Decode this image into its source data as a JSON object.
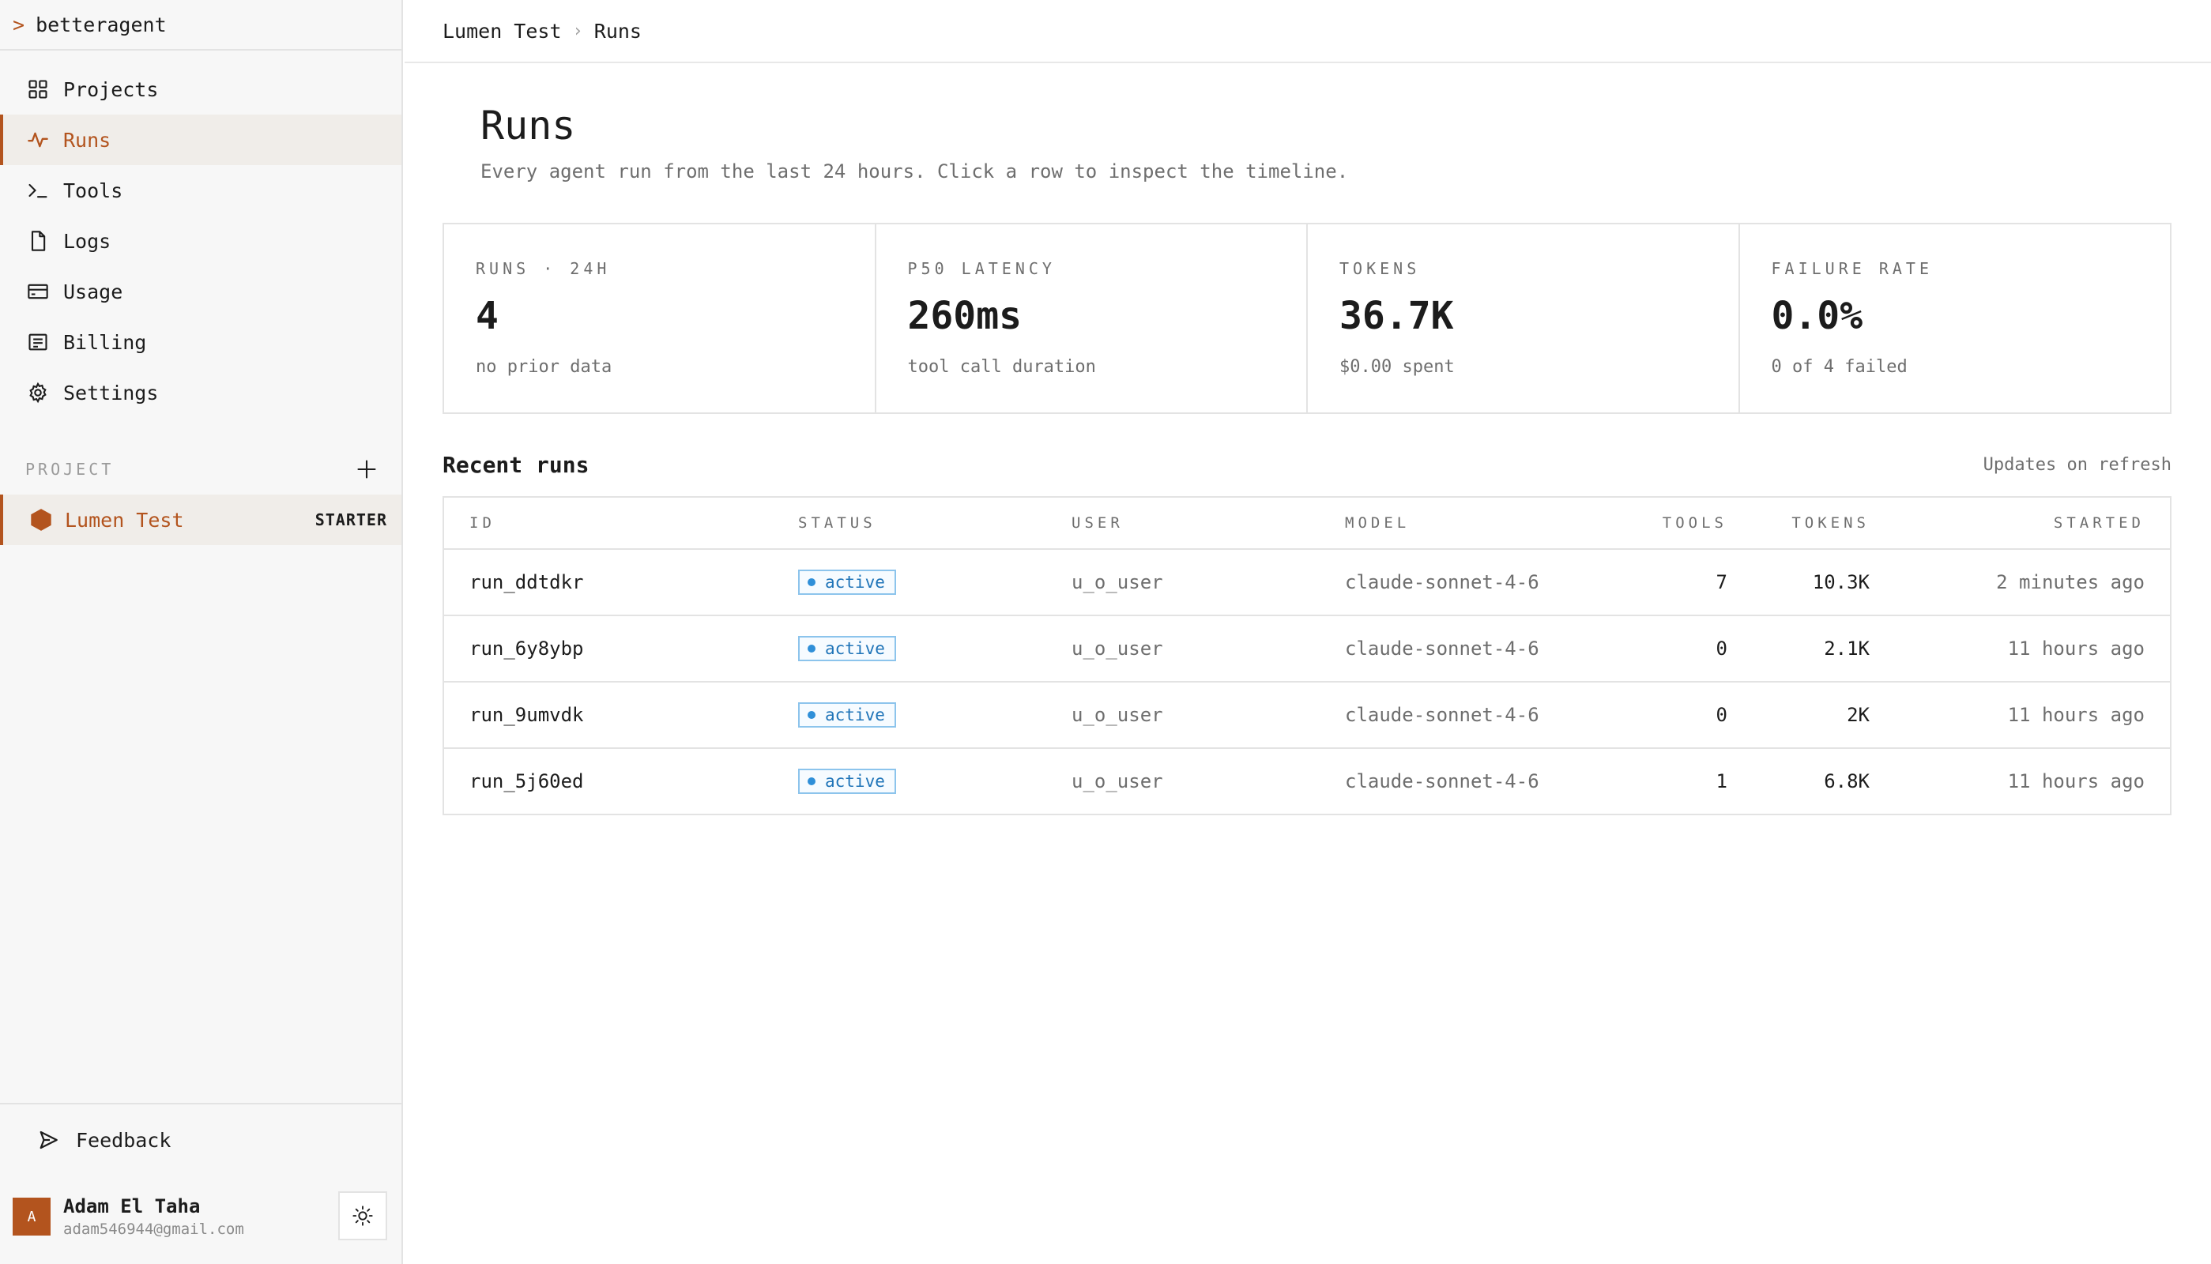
{
  "app": {
    "prompt_glyph": ">",
    "brand": "betteragent"
  },
  "sidebar": {
    "nav": [
      {
        "label": "Projects",
        "icon": "grid-icon"
      },
      {
        "label": "Runs",
        "icon": "activity-icon",
        "active": true
      },
      {
        "label": "Tools",
        "icon": "terminal-icon"
      },
      {
        "label": "Logs",
        "icon": "file-icon"
      },
      {
        "label": "Usage",
        "icon": "card-icon"
      },
      {
        "label": "Billing",
        "icon": "receipt-icon"
      },
      {
        "label": "Settings",
        "icon": "gear-icon"
      }
    ],
    "project_section_label": "PROJECT",
    "project": {
      "name": "Lumen Test",
      "plan": "STARTER"
    },
    "feedback_label": "Feedback",
    "user": {
      "initial": "A",
      "name": "Adam El Taha",
      "email": "adam546944@gmail.com"
    }
  },
  "breadcrumb": {
    "project": "Lumen Test",
    "page": "Runs"
  },
  "page": {
    "title": "Runs",
    "subtitle": "Every agent run from the last 24 hours. Click a row to inspect the timeline."
  },
  "stats": [
    {
      "label": "RUNS · 24H",
      "value": "4",
      "sub": "no prior data"
    },
    {
      "label": "P50 LATENCY",
      "value": "260ms",
      "sub": "tool call duration"
    },
    {
      "label": "TOKENS",
      "value": "36.7K",
      "sub": "$0.00 spent"
    },
    {
      "label": "FAILURE RATE",
      "value": "0.0%",
      "sub": "0 of 4 failed"
    }
  ],
  "recent": {
    "title": "Recent runs",
    "update_note": "Updates on refresh",
    "columns": {
      "id": "ID",
      "status": "STATUS",
      "user": "USER",
      "model": "MODEL",
      "tools": "TOOLS",
      "tokens": "TOKENS",
      "started": "STARTED"
    },
    "rows": [
      {
        "id": "run_ddtdkr",
        "status": "active",
        "user": "u_o_user",
        "model": "claude-sonnet-4-6",
        "tools": "7",
        "tokens": "10.3K",
        "started": "2 minutes ago"
      },
      {
        "id": "run_6y8ybp",
        "status": "active",
        "user": "u_o_user",
        "model": "claude-sonnet-4-6",
        "tools": "0",
        "tokens": "2.1K",
        "started": "11 hours ago"
      },
      {
        "id": "run_9umvdk",
        "status": "active",
        "user": "u_o_user",
        "model": "claude-sonnet-4-6",
        "tools": "0",
        "tokens": "2K",
        "started": "11 hours ago"
      },
      {
        "id": "run_5j60ed",
        "status": "active",
        "user": "u_o_user",
        "model": "claude-sonnet-4-6",
        "tools": "1",
        "tokens": "6.8K",
        "started": "11 hours ago"
      }
    ]
  },
  "colors": {
    "accent": "#b3541e",
    "status_active": "#1f74b8"
  }
}
